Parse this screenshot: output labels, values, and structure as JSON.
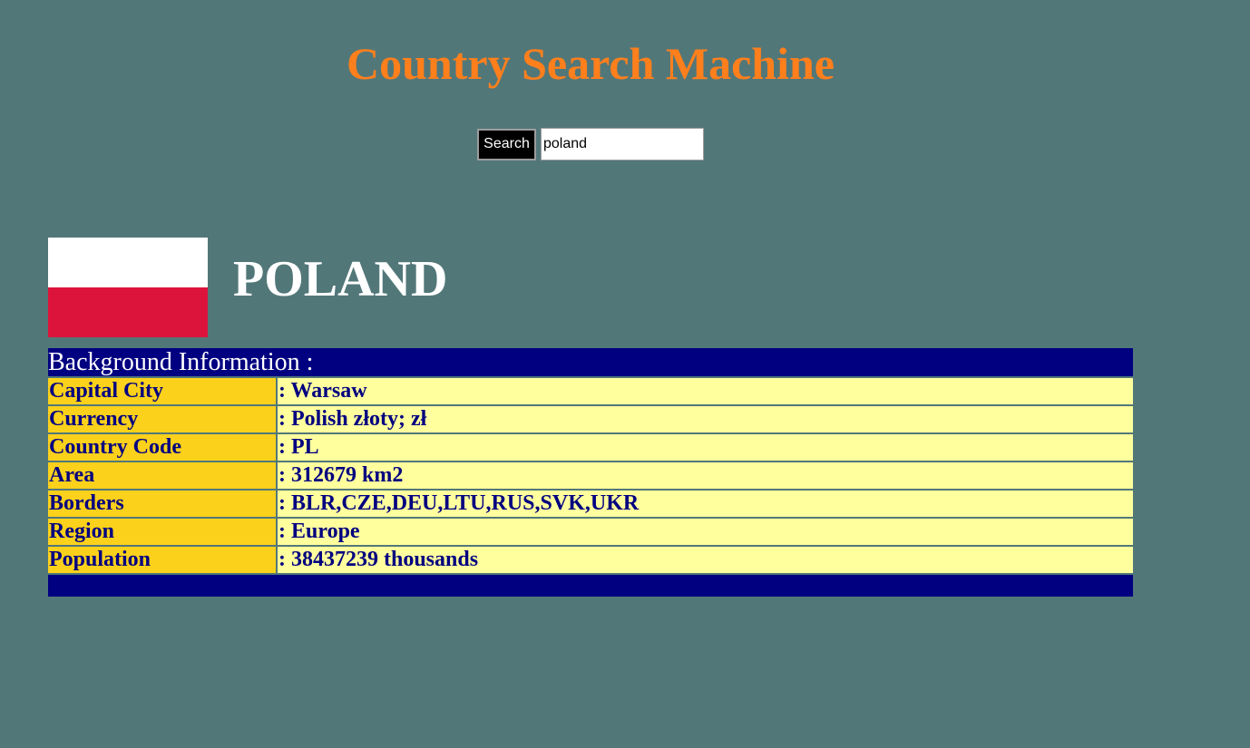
{
  "header": {
    "title": "Country Search Machine"
  },
  "search": {
    "button_label": "Search",
    "value": "poland"
  },
  "country": {
    "name": "POLAND",
    "flag": {
      "top_color": "#ffffff",
      "bottom_color": "#dc143c"
    }
  },
  "info": {
    "heading": "Background Information :",
    "rows": [
      {
        "label": "Capital City",
        "value": ": Warsaw"
      },
      {
        "label": "Currency",
        "value": ": Polish złoty; zł"
      },
      {
        "label": "Country Code",
        "value": ": PL"
      },
      {
        "label": "Area",
        "value": ": 312679 km2"
      },
      {
        "label": "Borders",
        "value": ": BLR,CZE,DEU,LTU,RUS,SVK,UKR"
      },
      {
        "label": "Region",
        "value": ": Europe"
      },
      {
        "label": "Population",
        "value": ": 38437239 thousands"
      }
    ]
  },
  "colors": {
    "page_background": "#527779",
    "title": "#ff7f1c",
    "table_header": "#000080",
    "label_cell": "#fcd11b",
    "value_cell": "#ffff9e"
  }
}
